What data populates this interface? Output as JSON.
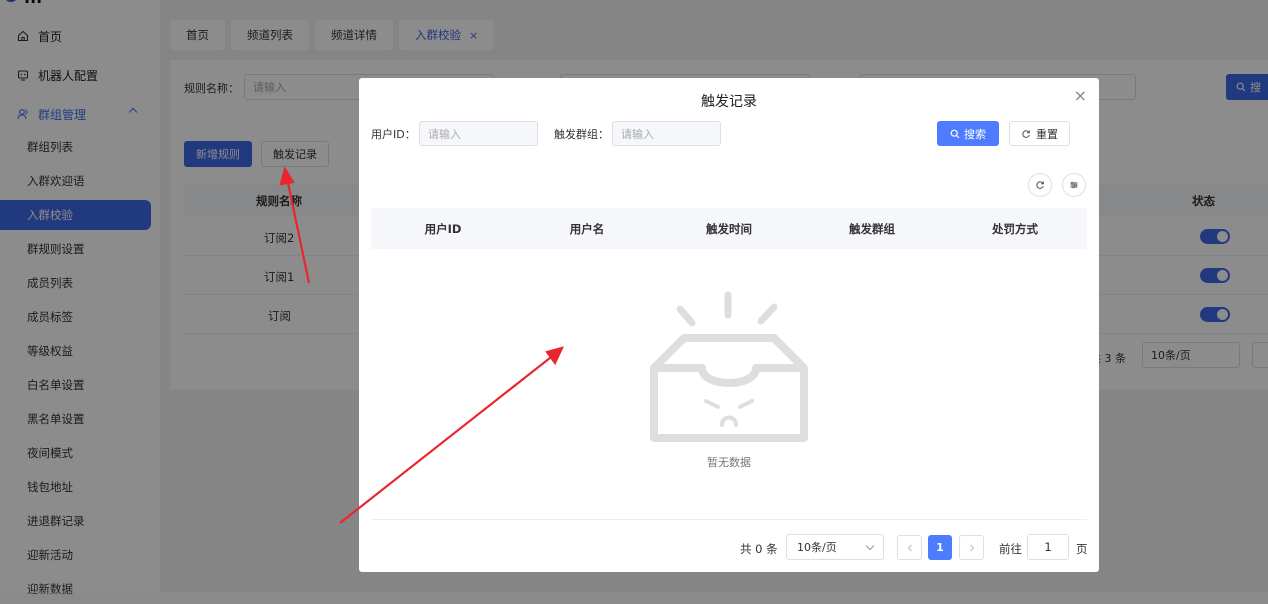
{
  "logo": {
    "text": "..."
  },
  "sidebar": {
    "home_label": "首页",
    "robot_label": "机器人配置",
    "group_label": "群组管理",
    "sub_items": [
      "群组列表",
      "入群欢迎语",
      "入群校验",
      "群规则设置",
      "成员列表",
      "成员标签",
      "等级权益",
      "白名单设置",
      "黑名单设置",
      "夜间模式",
      "钱包地址",
      "进退群记录",
      "迎新活动",
      "迎新数据"
    ],
    "active_index": 2
  },
  "tabs": [
    {
      "label": "首页"
    },
    {
      "label": "频道列表"
    },
    {
      "label": "频道详情"
    },
    {
      "label": "入群校验",
      "active": true,
      "close": "×"
    }
  ],
  "background": {
    "filter_label": "规则名称：",
    "filter_placeholder": "请输入",
    "search_label": "搜",
    "add_button": "新增规则",
    "log_button": "触发记录",
    "col_name": "规则名称",
    "col_status": "状态",
    "rows": [
      "订阅2",
      "订阅1",
      "订阅"
    ],
    "total": "共 3 条",
    "page_size": "10条/页"
  },
  "modal": {
    "title": "触发记录",
    "close": "×",
    "user_id_label": "用户ID：",
    "user_id_placeholder": "请输入",
    "group_label": "触发群组：",
    "group_placeholder": "请输入",
    "search_button": "搜索",
    "reset_button": "重置",
    "columns": [
      "用户ID",
      "用户名",
      "触发时间",
      "触发群组",
      "处罚方式"
    ],
    "empty_text": "暂无数据",
    "pager": {
      "total": "共 0 条",
      "size": "10条/页",
      "current": "1",
      "goto": "前往",
      "jump_value": "1",
      "page_suffix": "页"
    }
  },
  "colors": {
    "accent": "#3d68e6",
    "annotation": "#e8262c"
  }
}
